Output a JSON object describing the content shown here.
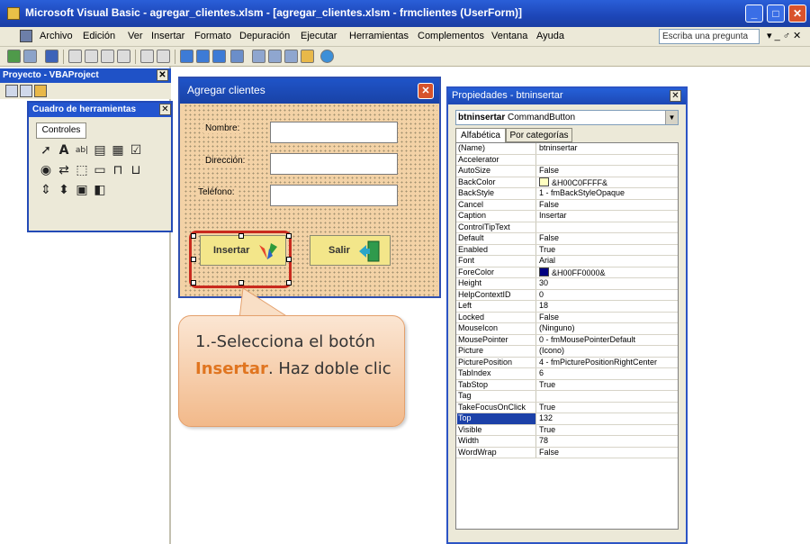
{
  "window": {
    "title": "Microsoft Visual Basic - agregar_clientes.xlsm - [agregar_clientes.xlsm - frmclientes (UserForm)]"
  },
  "menu": {
    "items": [
      "Archivo",
      "Edición",
      "Ver",
      "Insertar",
      "Formato",
      "Depuración",
      "Ejecutar",
      "Herramientas",
      "Complementos",
      "Ventana",
      "Ayuda"
    ],
    "ask_placeholder": "Escriba una pregunta"
  },
  "project": {
    "title": "Proyecto - VBAProject"
  },
  "toolbox": {
    "title": "Cuadro de herramientas",
    "tab": "Controles"
  },
  "userform": {
    "title": "Agregar clientes",
    "labels": {
      "nombre": "Nombre:",
      "direccion": "Dirección:",
      "telefono": "Teléfono:"
    },
    "buttons": {
      "insertar": "Insertar",
      "salir": "Salir"
    }
  },
  "callout": {
    "prefix": "1.-Selecciona el botón ",
    "highlight": "Insertar",
    "suffix": ". Haz doble clic"
  },
  "properties": {
    "title": "Propiedades - btninsertar",
    "object_name": "btninsertar",
    "object_type": "CommandButton",
    "tabs": [
      "Alfabética",
      "Por categorías"
    ],
    "rows": [
      {
        "name": "(Name)",
        "value": "btninsertar"
      },
      {
        "name": "Accelerator",
        "value": ""
      },
      {
        "name": "AutoSize",
        "value": "False"
      },
      {
        "name": "BackColor",
        "value": "&H00C0FFFF&"
      },
      {
        "name": "BackStyle",
        "value": "1 - fmBackStyleOpaque"
      },
      {
        "name": "Cancel",
        "value": "False"
      },
      {
        "name": "Caption",
        "value": "Insertar"
      },
      {
        "name": "ControlTipText",
        "value": ""
      },
      {
        "name": "Default",
        "value": "False"
      },
      {
        "name": "Enabled",
        "value": "True"
      },
      {
        "name": "Font",
        "value": "Arial"
      },
      {
        "name": "ForeColor",
        "value": "&H00FF0000&"
      },
      {
        "name": "Height",
        "value": "30"
      },
      {
        "name": "HelpContextID",
        "value": "0"
      },
      {
        "name": "Left",
        "value": "18"
      },
      {
        "name": "Locked",
        "value": "False"
      },
      {
        "name": "MouseIcon",
        "value": "(Ninguno)"
      },
      {
        "name": "MousePointer",
        "value": "0 - fmMousePointerDefault"
      },
      {
        "name": "Picture",
        "value": "(Icono)"
      },
      {
        "name": "PicturePosition",
        "value": "4 - fmPicturePositionRightCenter"
      },
      {
        "name": "TabIndex",
        "value": "6"
      },
      {
        "name": "TabStop",
        "value": "True"
      },
      {
        "name": "Tag",
        "value": ""
      },
      {
        "name": "TakeFocusOnClick",
        "value": "True"
      },
      {
        "name": "Top",
        "value": "132"
      },
      {
        "name": "Visible",
        "value": "True"
      },
      {
        "name": "Width",
        "value": "78"
      },
      {
        "name": "WordWrap",
        "value": "False"
      }
    ],
    "selected_row": "Top",
    "colors": {
      "backcolor": "#ffffc0",
      "forecolor": "#000080"
    }
  }
}
